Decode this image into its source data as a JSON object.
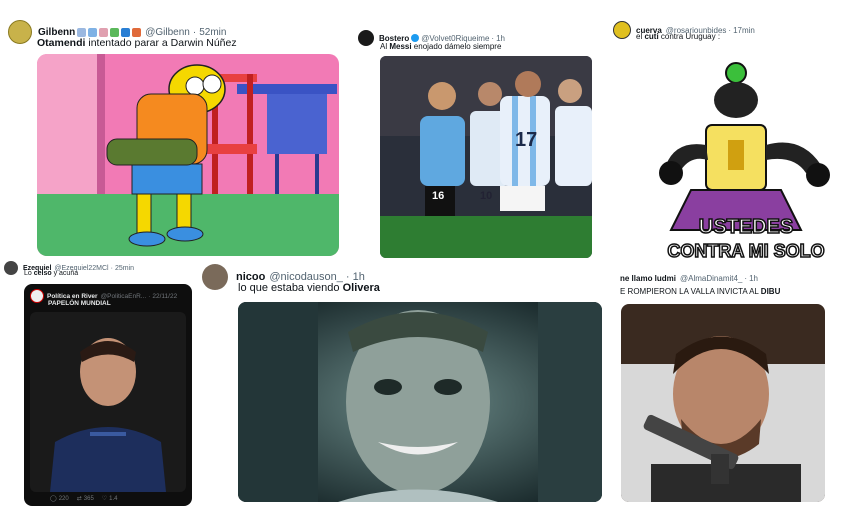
{
  "tweets": [
    {
      "name": "Gilbenn",
      "handle": "@Gilbenn",
      "time": "52min",
      "text_pre": "Otamendi",
      "text_post": " intentado parar a Darwin Núñez"
    },
    {
      "name": "Bostero",
      "handle": "@Volvet0Riqueime",
      "time": "1h",
      "text_pre": "Al ",
      "text_bold": "Messi",
      "text_post": " enojado dámelo siempre"
    },
    {
      "name": "cuerva",
      "handle": "@rosariounbides",
      "time": "17min",
      "text_pre": "el ",
      "text_bold": "cuti",
      "text_post": " contra Uruguay :"
    },
    {
      "name": "Ezequiel",
      "handle": "@Ezequiel22MCl",
      "time": "25min",
      "text_pre": "Lo ",
      "text_bold": "celso",
      "text_post": " y acuña"
    },
    {
      "name": "nicoo",
      "handle": "@nicodauson_",
      "time": "1h",
      "text_pre": "lo que estaba viendo ",
      "text_bold": "Olivera"
    },
    {
      "name": "ne llamo ludmi",
      "handle": "@AlmaDinamit4_",
      "time": "1h",
      "text_pre": "E ROMPIERON LA VALLA INVICTA AL ",
      "text_bold": "DIBU"
    }
  ],
  "meme_text": {
    "line1": "USTEDES",
    "line2": "CONTRA MI SOLO"
  },
  "quoted": {
    "name": "Política en River",
    "handle": "@PoliticaEnR...",
    "time": "22/11/22",
    "text": "PAPELÓN MUNDIAL"
  },
  "jersey_numbers": [
    "16",
    "10",
    "17"
  ],
  "stats": {
    "replies": "220",
    "retweets": "365",
    "likes": "1.4"
  }
}
